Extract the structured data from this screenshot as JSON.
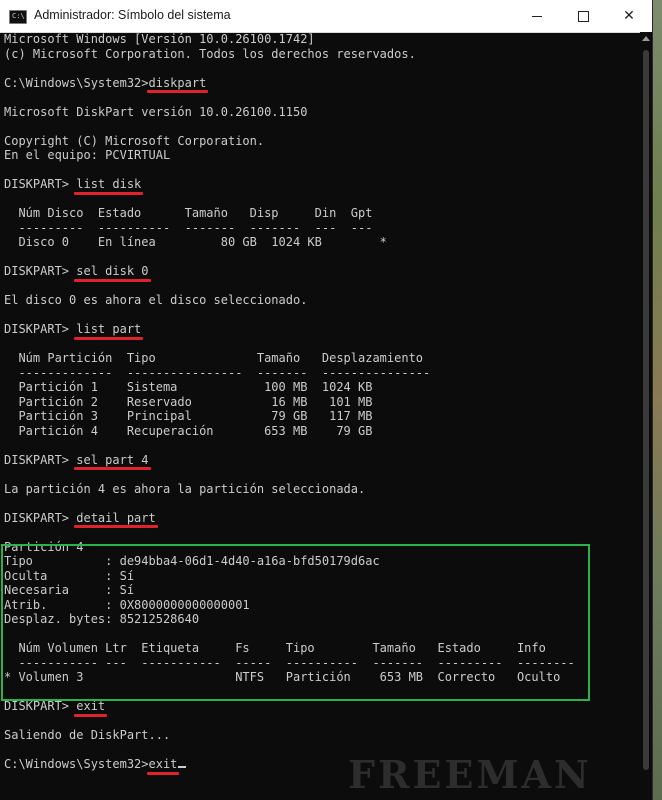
{
  "window": {
    "title": "Administrador: Símbolo del sistema",
    "icon_label": "C:\\",
    "minimize_icon": "minimize-icon",
    "maximize_icon": "maximize-icon",
    "close_icon": "close-icon",
    "close_glyph": "✕"
  },
  "colors": {
    "console_bg": "#0c0c0c",
    "console_text": "#cccccc",
    "underline": "#e0222a",
    "highlight_box": "#2bb24c"
  },
  "console": {
    "line_01": "Microsoft Windows [Versión 10.0.26100.1742]",
    "line_02": "(c) Microsoft Corporation. Todos los derechos reservados.",
    "prompt_1": "C:\\Windows\\System32>",
    "cmd_diskpart": "diskpart",
    "line_diskpart_version": "Microsoft DiskPart versión 10.0.26100.1150",
    "line_copyright": "Copyright (C) Microsoft Corporation.",
    "line_equipo": "En el equipo: PCVIRTUAL",
    "dp_prompt": "DISKPART> ",
    "cmd_list_disk": "list disk",
    "disk_header": "  Núm Disco  Estado      Tamaño   Disp     Din  Gpt",
    "disk_sep": "  ---------  ----------  -------  -------  ---  ---",
    "disk_row_0": "  Disco 0    En línea         80 GB  1024 KB        *",
    "cmd_sel_disk": "sel disk 0",
    "msg_disk_selected": "El disco 0 es ahora el disco seleccionado.",
    "cmd_list_part": "list part",
    "part_header": "  Núm Partición  Tipo              Tamaño   Desplazamiento",
    "part_sep": "  -------------  ----------------  -------  ---------------",
    "part_row_1": "  Partición 1    Sistema            100 MB  1024 KB",
    "part_row_2": "  Partición 2    Reservado           16 MB   101 MB",
    "part_row_3": "  Partición 3    Principal           79 GB   117 MB",
    "part_row_4": "  Partición 4    Recuperación       653 MB    79 GB",
    "cmd_sel_part": "sel part 4",
    "msg_part_selected": "La partición 4 es ahora la partición seleccionada.",
    "cmd_detail_part": "detail part",
    "detail_title": "Partición 4",
    "detail_tipo": "Tipo          : de94bba4-06d1-4d40-a16a-bfd50179d6ac",
    "detail_oculta": "Oculta        : Sí",
    "detail_necesaria": "Necesaria     : Sí",
    "detail_atrib": "Atrib.        : 0X8000000000000001",
    "detail_desplaz": "Desplaz. bytes: 85212528640",
    "vol_header": "  Núm Volumen Ltr  Etiqueta     Fs     Tipo        Tamaño   Estado     Info",
    "vol_sep": "  ----------- ---  -----------  -----  ----------  -------  ---------  --------",
    "vol_row": "* Volumen 3                     NTFS   Partición    653 MB  Correcto   Oculto",
    "cmd_exit": "exit",
    "msg_exit": "Saliendo de DiskPart...",
    "prompt_2": "C:\\Windows\\System32>",
    "cmd_exit_2": "exit"
  },
  "watermark": "FREEMAN"
}
